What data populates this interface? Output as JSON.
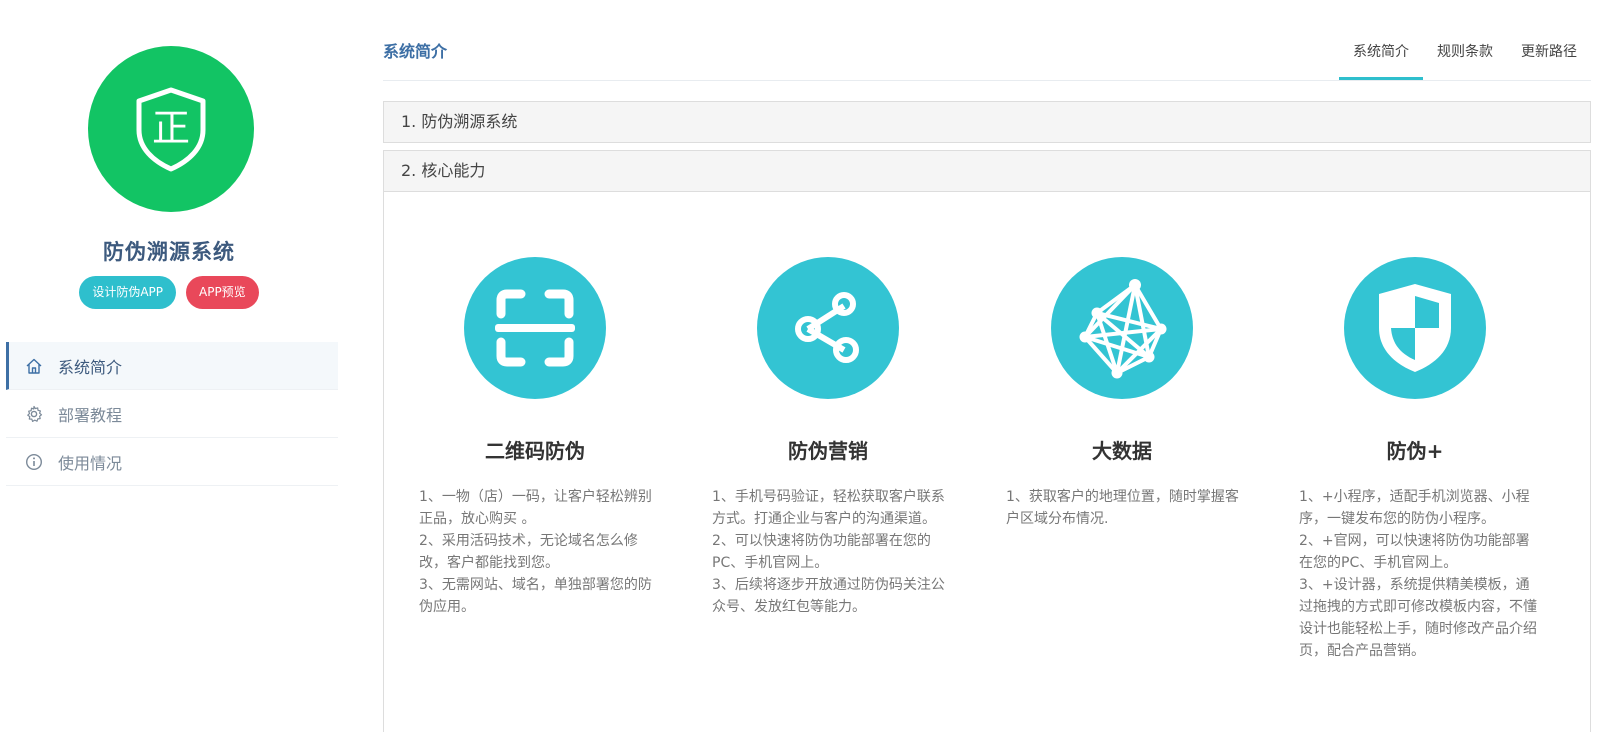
{
  "sidebar": {
    "logo_icon": "shield-zheng-icon",
    "logo_text": "正",
    "logo_color": "#12c464",
    "app_name": "防伪溯源系统",
    "buttons": [
      {
        "label": "设计防伪APP",
        "color": "#2ebfcd"
      },
      {
        "label": "APP预览",
        "color": "#e9485a"
      }
    ],
    "nav": [
      {
        "label": "系统简介",
        "icon": "home-icon",
        "active": true
      },
      {
        "label": "部署教程",
        "icon": "gear-icon",
        "active": false
      },
      {
        "label": "使用情况",
        "icon": "info-icon",
        "active": false
      }
    ]
  },
  "main": {
    "title": "系统简介",
    "tabs": [
      {
        "label": "系统简介",
        "active": true
      },
      {
        "label": "规则条款",
        "active": false
      },
      {
        "label": "更新路径",
        "active": false
      }
    ],
    "panels": [
      {
        "title": "1. 防伪溯源系统"
      },
      {
        "title": "2. 核心能力"
      }
    ],
    "accent_color": "#33c4d3",
    "features": [
      {
        "icon": "qr-scan-icon",
        "title": "二维码防伪",
        "lines": [
          "1、一物（店）一码，让客户轻松辨别正品，放心购买 。",
          "2、采用活码技术，无论域名怎么修改，客户都能找到您。",
          "3、无需网站、域名，单独部署您的防伪应用。"
        ]
      },
      {
        "icon": "share-icon",
        "title": "防伪营销",
        "lines": [
          "1、手机号码验证，轻松获取客户联系方式。打通企业与客户的沟通渠道。",
          "2、可以快速将防伪功能部署在您的PC、手机官网上。",
          "3、后续将逐步开放通过防伪码关注公众号、发放红包等能力。"
        ]
      },
      {
        "icon": "network-icon",
        "title": "大数据",
        "lines": [
          "1、获取客户的地理位置，随时掌握客户区域分布情况."
        ]
      },
      {
        "icon": "shield-icon",
        "title": "防伪+",
        "lines": [
          "1、+小程序，适配手机浏览器、小程序，一键发布您的防伪小程序。",
          "2、+官网，可以快速将防伪功能部署在您的PC、手机官网上。",
          "3、+设计器，系统提供精美模板，通过拖拽的方式即可修改模板内容，不懂设计也能轻松上手，随时修改产品介绍页，配合产品营销。"
        ]
      }
    ]
  }
}
